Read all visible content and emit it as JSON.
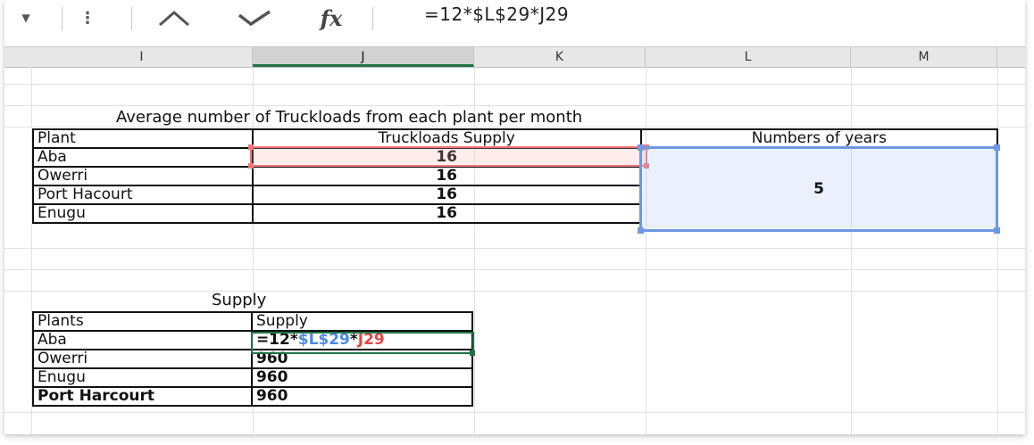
{
  "formula_bar": {
    "fx_label": "fx",
    "formula": "=12*$L$29*J29"
  },
  "icons": {
    "name_box_dropdown": "chevron-down-icon",
    "more": "vertical-dots-icon",
    "cancel": "cancel-icon",
    "enter": "checkmark-icon"
  },
  "columns": [
    "I",
    "J",
    "K",
    "L",
    "M"
  ],
  "colors": {
    "selected_column_underline": "#217346",
    "formula_blue": "#4a88e8",
    "formula_red": "#e04646"
  },
  "table1": {
    "title": "Average number of Truckloads  from each plant per month",
    "headers": {
      "plant": "Plant",
      "truckloads": "Truckloads Supply",
      "years": "Numbers of years"
    },
    "rows": [
      {
        "plant": "Aba",
        "value": "16"
      },
      {
        "plant": "Owerri",
        "value": "16"
      },
      {
        "plant": "Port Hacourt",
        "value": "16"
      },
      {
        "plant": "Enugu",
        "value": "16"
      }
    ],
    "years_value": "5"
  },
  "table2": {
    "title": "Supply",
    "headers": {
      "plants": "Plants",
      "supply": "Supply"
    },
    "formula_parts": {
      "prefix": "=12*",
      "ref_blue": "$L$29",
      "mid": "*",
      "ref_red": "J29"
    },
    "rows": [
      {
        "plant": "Aba"
      },
      {
        "plant": "Owerri",
        "value": "960"
      },
      {
        "plant": "Enugu",
        "value": "960"
      },
      {
        "plant": "Port Harcourt",
        "value": "960"
      }
    ]
  }
}
